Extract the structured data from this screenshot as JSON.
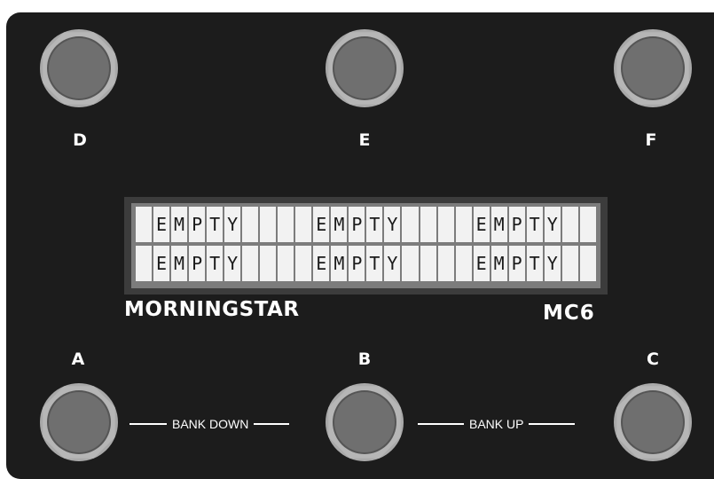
{
  "device": {
    "brand": "MORNINGSTAR",
    "model": "MC6",
    "colors": {
      "body": "#1c1c1c",
      "switch_outer": "#a9a9a9",
      "switch_inner": "#6f6f6f",
      "lcd_cell": "#f2f2f2"
    }
  },
  "switches": {
    "top": [
      {
        "label": "D",
        "icon": "footswitch-icon"
      },
      {
        "label": "E",
        "icon": "footswitch-icon"
      },
      {
        "label": "F",
        "icon": "footswitch-icon"
      }
    ],
    "bottom": [
      {
        "label": "A",
        "icon": "footswitch-icon"
      },
      {
        "label": "B",
        "icon": "footswitch-icon"
      },
      {
        "label": "C",
        "icon": "footswitch-icon"
      }
    ]
  },
  "lcd": {
    "rows": [
      [
        "",
        "E",
        "M",
        "P",
        "T",
        "Y",
        "",
        "",
        "",
        "",
        "E",
        "M",
        "P",
        "T",
        "Y",
        "",
        "",
        "",
        "",
        "E",
        "M",
        "P",
        "T",
        "Y",
        "",
        ""
      ],
      [
        "",
        "E",
        "M",
        "P",
        "T",
        "Y",
        "",
        "",
        "",
        "",
        "E",
        "M",
        "P",
        "T",
        "Y",
        "",
        "",
        "",
        "",
        "E",
        "M",
        "P",
        "T",
        "Y",
        "",
        ""
      ]
    ]
  },
  "bank": {
    "down_label": "BANK DOWN",
    "up_label": "BANK UP"
  }
}
